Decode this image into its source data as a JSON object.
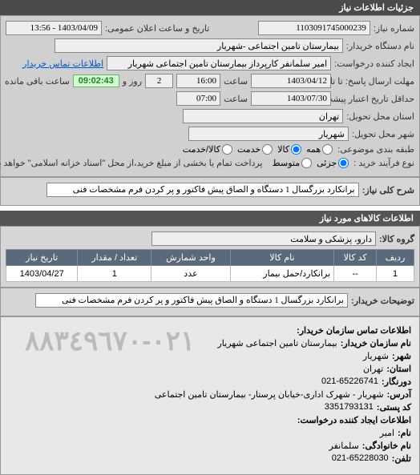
{
  "panel_title": "جزئیات اطلاعات نیاز",
  "fields": {
    "need_number_label": "شماره نیاز:",
    "need_number": "1103091745000239",
    "announce_label": "تاریخ و ساعت اعلان عمومی:",
    "announce_value": "1403/04/09 - 13:56",
    "buyer_org_label": "نام دستگاه خریدار:",
    "buyer_org": "بیمارستان تامین اجتماعی -شهریار",
    "buyer_contact_link": "اطلاعات تماس خریدار",
    "requester_label": "ایجاد کننده درخواست:",
    "requester": "امیر سلمانفر کارپرداز بیمارستان تامین اجتماعی شهریار",
    "deadline_send_label": "مهلت ارسال پاسخ: تا تاریخ:",
    "deadline_send_date": "1403/04/12",
    "deadline_send_time_label": "ساعت",
    "deadline_send_time": "16:00",
    "remain_days": "2",
    "remain_days_label": "روز و",
    "remain_time": "09:02:43",
    "remain_suffix": "ساعت باقی مانده",
    "validity_label": "حداقل تاریخ اعتبار پیشت: تا تاریخ:",
    "validity_date": "1403/07/30",
    "validity_time_label": "ساعت",
    "validity_time": "07:00",
    "province_label": "استان محل تحویل:",
    "province": "تهران",
    "city_label": "شهر محل تحویل:",
    "city": "شهریار",
    "category_label": "طبقه بندی موضوعی:",
    "radio_all": "همه",
    "radio_goods": "کالا",
    "radio_service": "خدمت",
    "radio_goods_service": "کالا/خدمت",
    "process_label": "نوع فرآیند خرید :",
    "radio_partial": "جزئی",
    "radio_medium": "متوسط",
    "process_note": "پرداخت تمام یا بخشی از مبلغ خرید،از محل \"اسناد خزانه اسلامی\" خواهد بود."
  },
  "need_desc": {
    "label": "شرح کلی نیاز:",
    "value": "برانکارد بزرگسال 1 دستگاه و الصاق پیش فاکتور و پر کردن فرم مشخصات فنی الزامیست"
  },
  "items_section": "اطلاعات کالاهای مورد نیاز",
  "group": {
    "label": "گروه کالا:",
    "value": "دارو، پزشکی و سلامت"
  },
  "table": {
    "headers": [
      "ردیف",
      "کد کالا",
      "نام کالا",
      "واحد شمارش",
      "تعداد / مقدار",
      "تاریخ نیاز"
    ],
    "rows": [
      {
        "idx": "1",
        "code": "--",
        "name": "برانکارد/حمل بیمار",
        "unit": "عدد",
        "qty": "1",
        "date": "1403/04/27"
      }
    ]
  },
  "buyer_notes": {
    "label": "توضیحات خریدار:",
    "value": "برانکارد بزرگسال 1 دستگاه و الصاق پیش فاکتور و پر کردن فرم مشخصات فنی الزامیست"
  },
  "contact_section": "اطلاعات تماس سازمان خریدار:",
  "contact": {
    "org_label": "نام سازمان خریدار:",
    "org": "بیمارستان تامین اجتماعی شهریار",
    "city_label": "شهر:",
    "city": "شهریار",
    "province_label": "استان:",
    "province": "تهران",
    "fax_label": "دورنگار:",
    "fax": "021-65226741",
    "address_label": "آدرس:",
    "address": "شهریار - شهرک اداری-خیابان پرستار- بیمارستان تامین اجتماعی",
    "postcode_label": "کد پستی:",
    "postcode": "3351793131",
    "creator_section": "اطلاعات ایجاد کننده درخواست:",
    "name_label": "نام:",
    "name": "امیر",
    "family_label": "نام خانوادگی:",
    "family": "سلمانفر",
    "phone_label": "تلفن:",
    "phone": "021-65228030",
    "watermark": "٠٢١-٨٨٣٤٩٦٧٠"
  }
}
